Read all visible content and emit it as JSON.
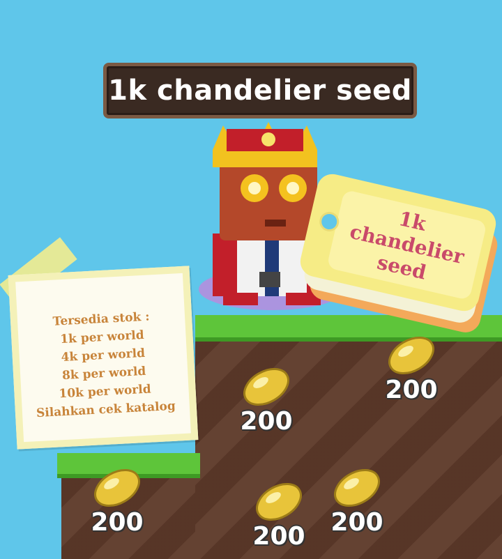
{
  "title": "1k chandelier seed",
  "tag": {
    "line1": "1k chandelier",
    "line2": "seed"
  },
  "note": {
    "lines": [
      "Tersedia stok :",
      "1k per world",
      "4k per world",
      "8k per world",
      "10k per world",
      "Silahkan cek katalog"
    ]
  },
  "seeds": [
    {
      "count": "200"
    },
    {
      "count": "200"
    },
    {
      "count": "200"
    },
    {
      "count": "200"
    },
    {
      "count": "200"
    }
  ],
  "colors": {
    "sky": "#5fc6ea",
    "grass": "#5ec53a",
    "dirt": "#5e3a2a",
    "seed_gold": "#e8c43a",
    "note_text": "#c8843a",
    "tag_text": "#c94a6a"
  },
  "icons": [
    "seed-icon",
    "crown-icon",
    "player-avatar"
  ]
}
